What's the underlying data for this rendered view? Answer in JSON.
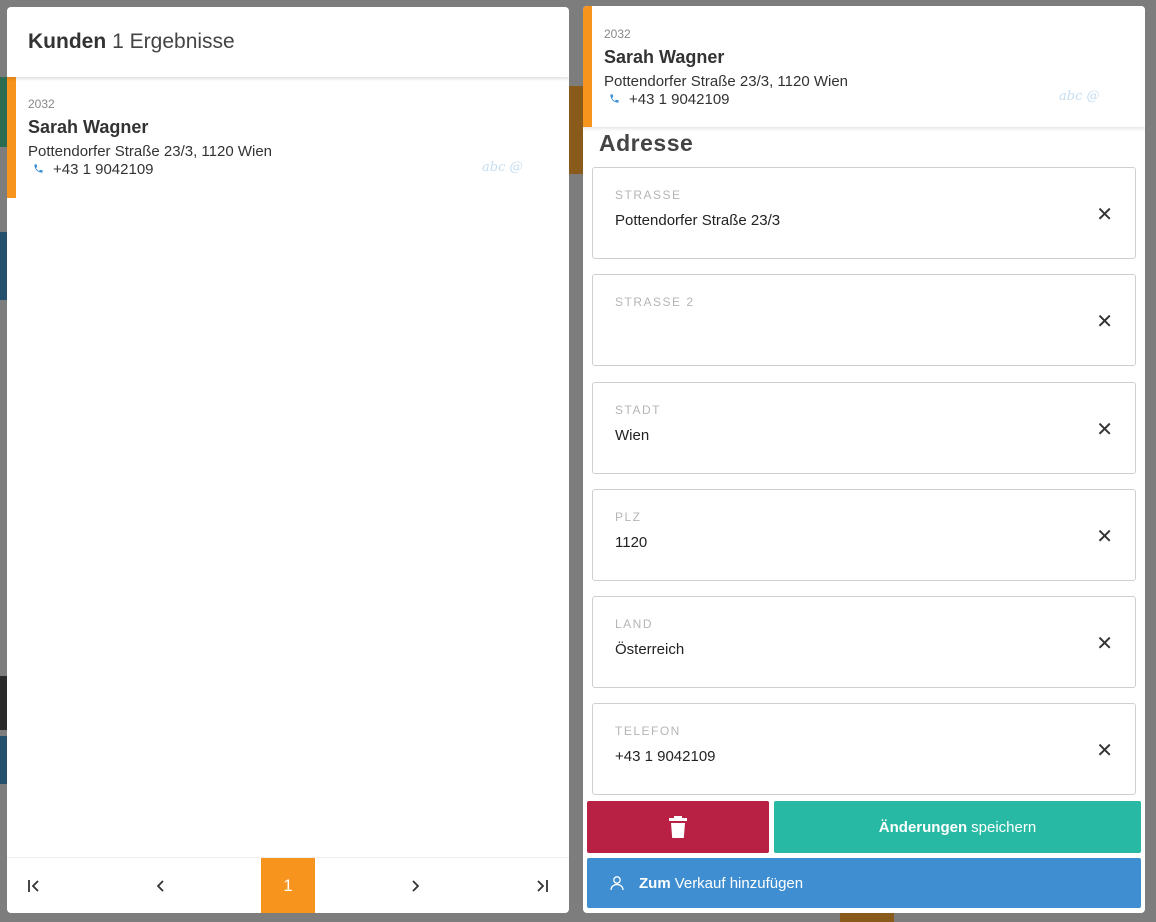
{
  "list": {
    "title": "Kunden",
    "results": "1 Ergebnisse",
    "customers": [
      {
        "id": "2032",
        "name": "Sarah Wagner",
        "address": "Pottendorfer Straße 23/3, 1120 Wien",
        "phone": "+43 1 9042109",
        "tag": "abc @"
      }
    ],
    "pager": {
      "first": "|<",
      "prev": "<",
      "current": "1",
      "next": ">",
      "last": ">|"
    }
  },
  "detail": {
    "id": "2032",
    "name": "Sarah Wagner",
    "address": "Pottendorfer Straße 23/3, 1120 Wien",
    "phone": "+43 1 9042109",
    "tag": "abc @",
    "section_title": "Adresse",
    "fields": [
      {
        "label": "STRASSE",
        "value": "Pottendorfer Straße 23/3"
      },
      {
        "label": "STRASSE 2",
        "value": ""
      },
      {
        "label": "STADT",
        "value": "Wien"
      },
      {
        "label": "PLZ",
        "value": "1120"
      },
      {
        "label": "LAND",
        "value": "Österreich"
      },
      {
        "label": "TELEFON",
        "value": "+43 1 9042109"
      }
    ],
    "clear_symbol": "✕",
    "save_strong": "Änderungen",
    "save_rest": "speichern",
    "add_strong": "Zum",
    "add_rest": "Verkauf hinzufügen",
    "colors": {
      "accent": "#f7941d",
      "delete": "#b82143",
      "save": "#27b9a3",
      "add": "#3f8ed1",
      "phone_icon": "#3d8fd6"
    },
    "icons": {
      "delete": "trash-icon",
      "add": "user-icon",
      "phone": "phone-icon",
      "clear": "close-icon"
    }
  }
}
